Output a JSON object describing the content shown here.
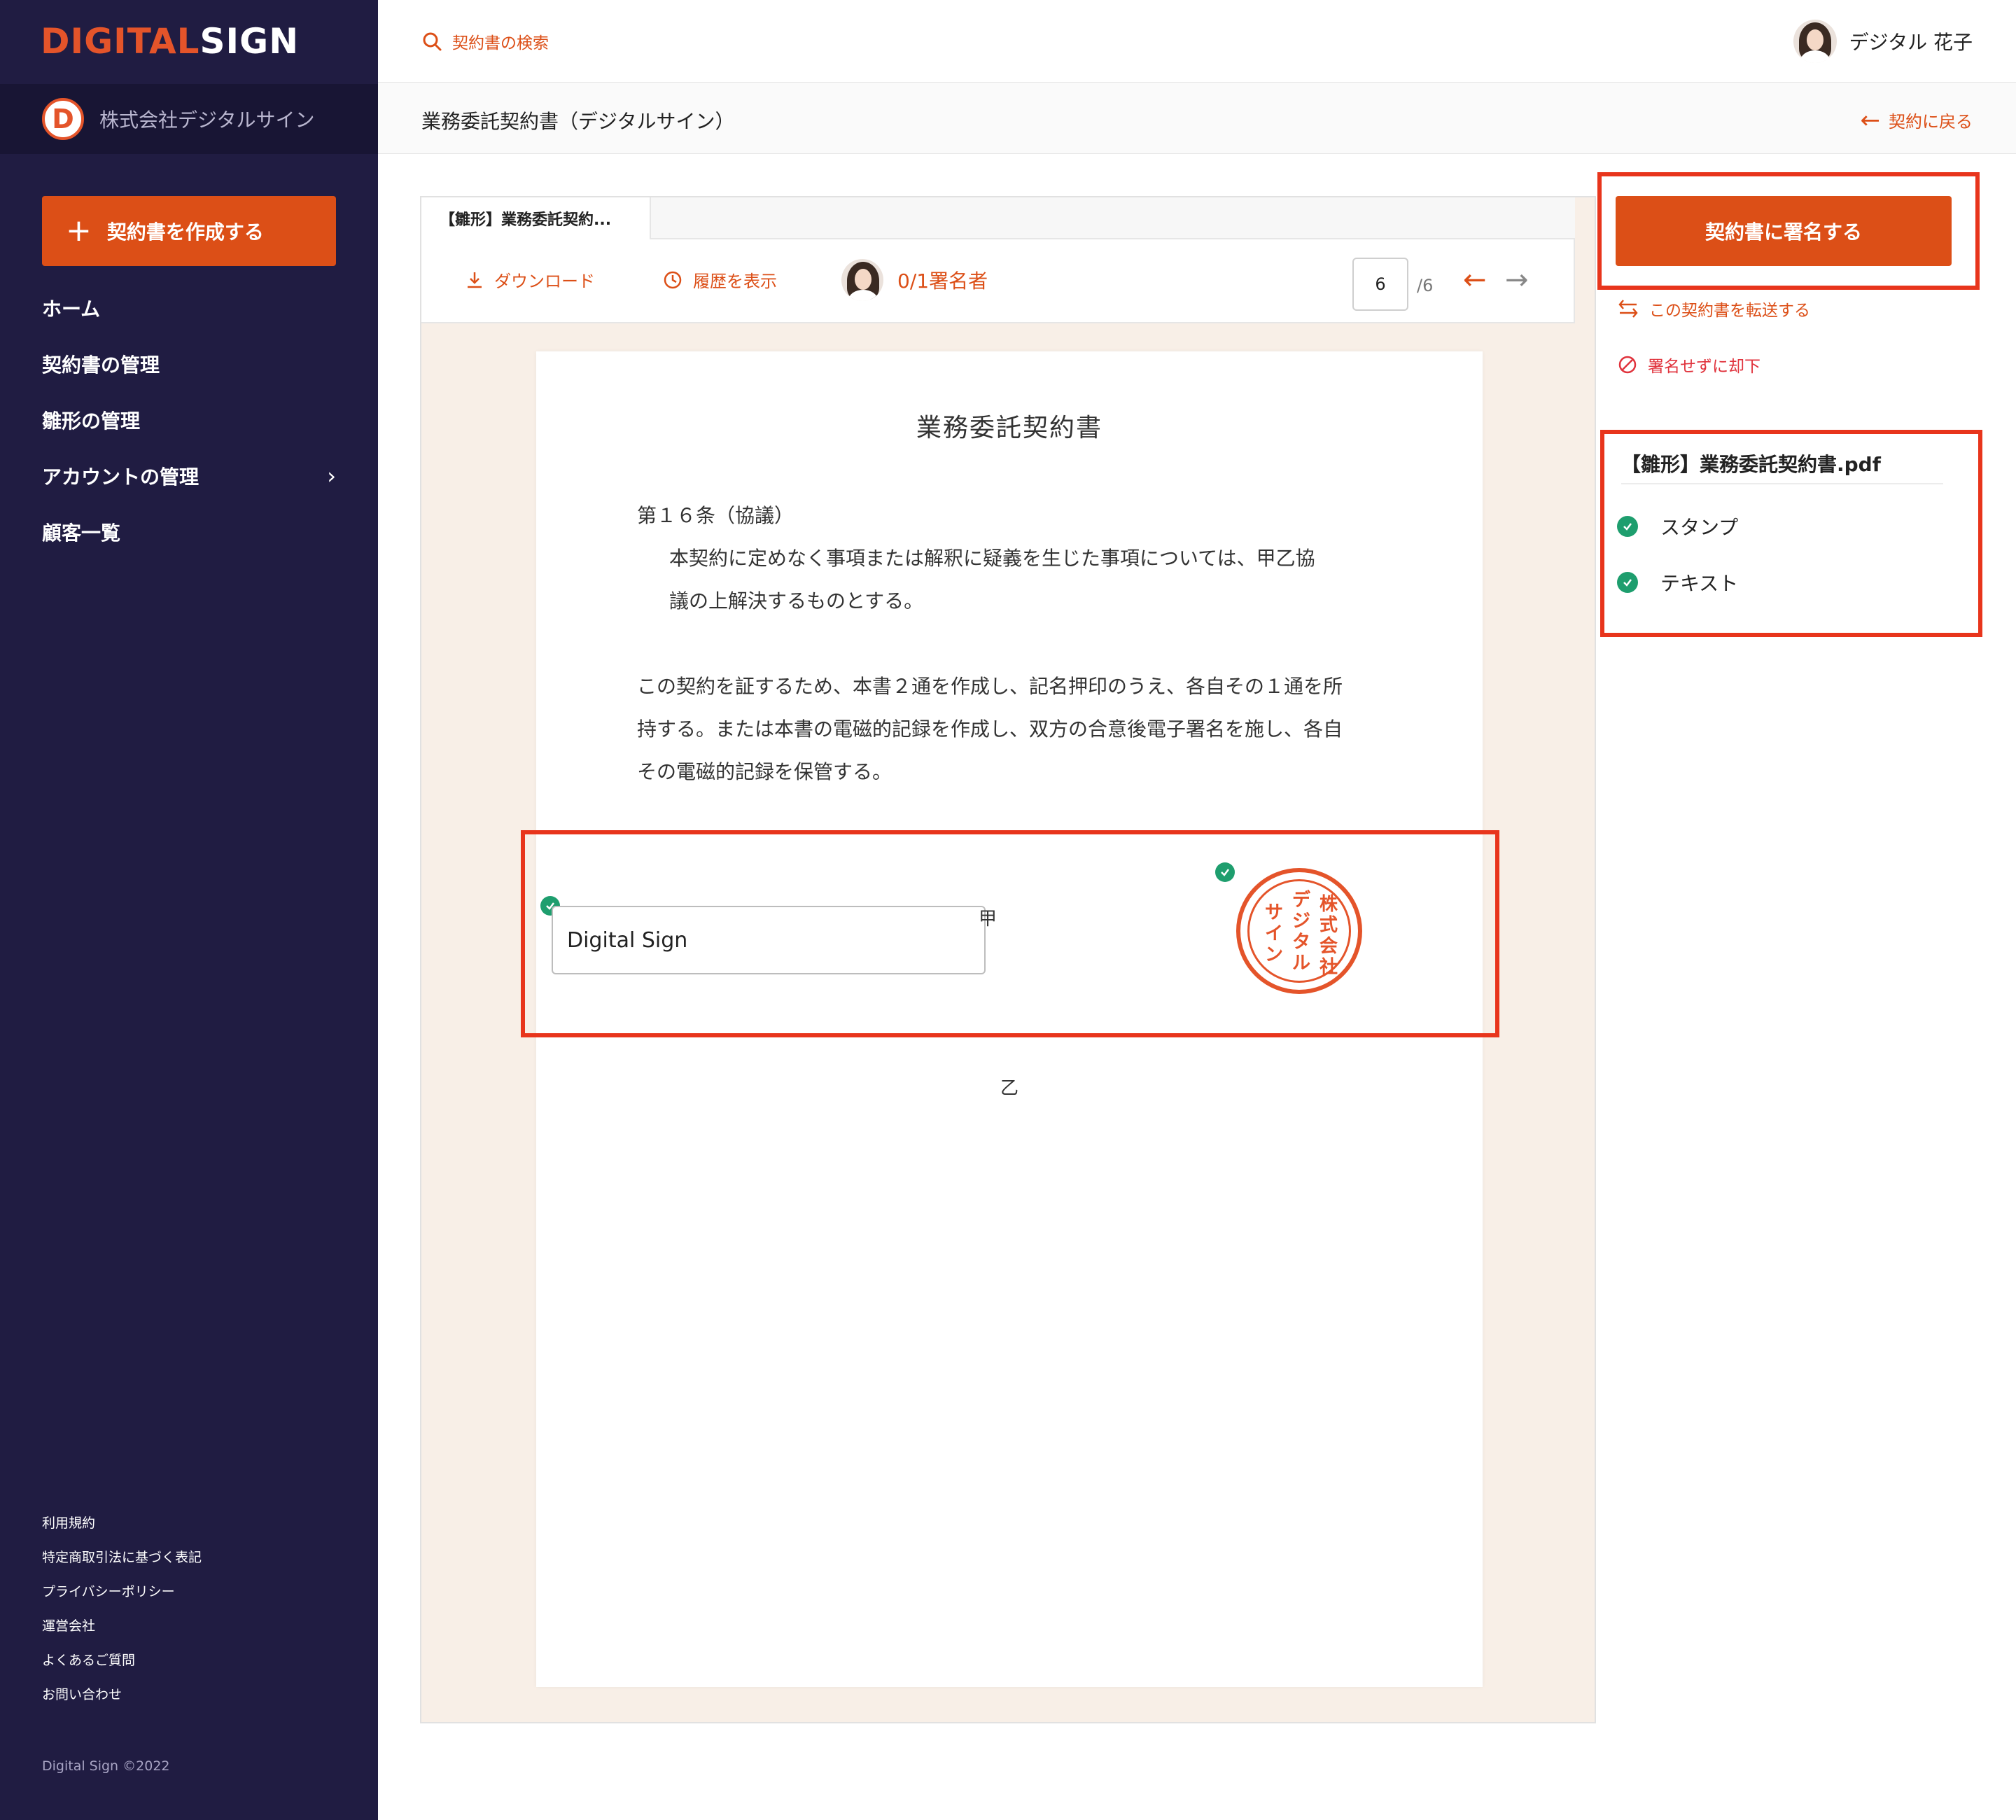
{
  "brand": {
    "logo_part1": "DIGITAL",
    "logo_part2": "SIGN",
    "accent": "#dc4f17"
  },
  "sidebar": {
    "company_initial": "D",
    "company_name": "株式会社デジタルサイン",
    "create_button": "契約書を作成する",
    "nav": [
      "ホーム",
      "契約書の管理",
      "雛形の管理",
      "アカウントの管理",
      "顧客一覧"
    ],
    "footer_links": [
      "利用規約",
      "特定商取引法に基づく表記",
      "プライバシーポリシー",
      "運営会社",
      "よくあるご質問",
      "お問い合わせ"
    ],
    "copyright": "Digital Sign ©2022"
  },
  "header": {
    "search_label": "契約書の検索",
    "user_name": "デジタル 花子",
    "doc_title": "業務委託契約書（デジタルサイン）",
    "back_label": "契約に戻る"
  },
  "viewer": {
    "tab_label": "【雛形】業務委託契約...",
    "download_label": "ダウンロード",
    "history_label": "履歴を表示",
    "signers_label": "0/1署名者",
    "current_page": "6",
    "total_pages": "/6"
  },
  "document": {
    "title": "業務委託契約書",
    "article_heading": "第１６条（協議）",
    "article_line1": "本契約に定めなく事項または解釈に疑義を生じた事項については、甲乙協",
    "article_line2": "議の上解決するものとする。",
    "closing_line1": "この契約を証するため、本書２通を作成し、記名押印のうえ、各自その１通を所",
    "closing_line2": "持する。または本書の電磁的記録を作成し、双方の合意後電子署名を施し、各自",
    "closing_line3": "その電磁的記録を保管する。",
    "party_a": "甲",
    "party_b": "乙",
    "sign_field_value": "Digital Sign",
    "seal_chars": [
      "株",
      "式",
      "会",
      "社",
      "デ",
      "ジ",
      "タ",
      "ル",
      "サ",
      "イ",
      "ン"
    ]
  },
  "right_panel": {
    "sign_button": "契約書に署名する",
    "forward_label": "この契約書を転送する",
    "reject_label": "署名せずに却下",
    "file_name": "【雛形】業務委託契約書.pdf",
    "fields": [
      "スタンプ",
      "テキスト"
    ]
  }
}
